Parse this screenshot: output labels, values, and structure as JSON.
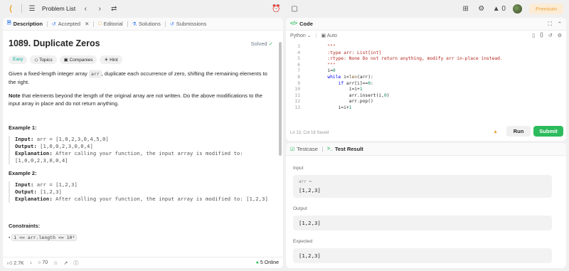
{
  "topnav": {
    "title": "Problem List",
    "avatar_alt": "",
    "streak": "0",
    "premium": "Premium"
  },
  "left_tabs": [
    {
      "label": "Description",
      "active": true
    },
    {
      "label": "Accepted"
    },
    {
      "label": "Editorial"
    },
    {
      "label": "Solutions"
    },
    {
      "label": "Submissions"
    }
  ],
  "problem": {
    "title": "1089. Duplicate Zeros",
    "status": "Solved",
    "chips": [
      "Easy",
      "Topics",
      "Companies",
      "Hint"
    ],
    "desc_p1_a": "Given a fixed-length integer array ",
    "desc_p1_code": "arr",
    "desc_p1_b": ", duplicate each occurrence of zero, shifting the remaining elements to the right.",
    "desc_p2_bold": "Note",
    "desc_p2_rest": " that elements beyond the length of the original array are not written. Do the above modifications to the input array in place and do not return anything.",
    "ex1_title": "Example 1:",
    "ex1_input_label": "Input:",
    "ex1_input": " arr = [1,0,2,3,0,4,5,0]",
    "ex1_output_label": "Output:",
    "ex1_output": " [1,0,0,2,3,0,0,4]",
    "ex1_expl_label": "Explanation:",
    "ex1_expl": " After calling your function, the input array is modified to: [1,0,0,2,3,0,0,4]",
    "ex2_title": "Example 2:",
    "ex2_input_label": "Input:",
    "ex2_input": " arr = [1,2,3]",
    "ex2_output_label": "Output:",
    "ex2_output": " [1,2,3]",
    "ex2_expl_label": "Explanation:",
    "ex2_expl": " After calling your function, the input array is modified to: [1,2,3]",
    "constraints_title": "Constraints:",
    "constraint1": "1 <= arr.length <= 10⁴"
  },
  "bottombar": {
    "likes": "2.7K",
    "comments": "70",
    "online": "5 Online"
  },
  "code_tab": {
    "label": "Code"
  },
  "editor": {
    "language": "Python",
    "mode": "Auto",
    "status": "Ln 13, Col 18    Saved",
    "run": "Run",
    "submit": "Submit"
  },
  "code_lines": [
    {
      "n": "3",
      "t": "        \"\"\""
    },
    {
      "n": "4",
      "t": "        :type arr: List[int]"
    },
    {
      "n": "5",
      "t": "        :rtype: None Do not return anything, modify arr in-place instead."
    },
    {
      "n": "6",
      "t": "        \"\"\""
    },
    {
      "n": "7",
      "t": "        i=0"
    },
    {
      "n": "8",
      "t": "        while i<len(arr):"
    },
    {
      "n": "9",
      "t": "            if arr[i]==0:"
    },
    {
      "n": "10",
      "t": "                i=i+1"
    },
    {
      "n": "11",
      "t": "                arr.insert(i,0)"
    },
    {
      "n": "12",
      "t": "                arr.pop()"
    },
    {
      "n": "13",
      "t": "            i=i+1"
    }
  ],
  "result_tabs": [
    {
      "label": "Testcase"
    },
    {
      "label": "Test Result",
      "active": true
    }
  ],
  "result": {
    "input_label": "Input",
    "input_var": "arr =",
    "input_val": "[1,2,3]",
    "output_label": "Output",
    "output_val": "[1,2,3]",
    "expected_label": "Expected",
    "expected_val": "[1,2,3]"
  }
}
